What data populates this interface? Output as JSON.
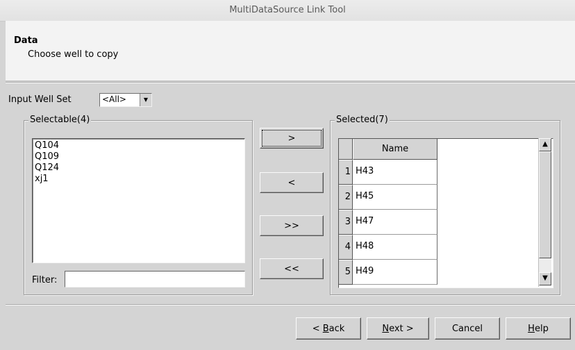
{
  "window": {
    "title": "MultiDataSource Link Tool"
  },
  "header": {
    "title": "Data",
    "subtitle": "Choose well to copy"
  },
  "input_well_set": {
    "label": "Input Well Set",
    "selected": "<All>"
  },
  "selectable": {
    "legend": "Selectable(4)",
    "items": [
      "Q104",
      "Q109",
      "Q124",
      "xj1"
    ],
    "filter_label": "Filter:",
    "filter_value": ""
  },
  "transfer_buttons": {
    "add": ">",
    "remove": "<",
    "add_all": ">>",
    "remove_all": "<<"
  },
  "selected": {
    "legend": "Selected(7)",
    "column": "Name",
    "rows": [
      {
        "num": "1",
        "name": "H43"
      },
      {
        "num": "2",
        "name": "H45"
      },
      {
        "num": "3",
        "name": "H47"
      },
      {
        "num": "4",
        "name": "H48"
      },
      {
        "num": "5",
        "name": "H49"
      }
    ]
  },
  "footer": {
    "back": {
      "mnemonic": "B",
      "rest": "ack",
      "prefix": "< "
    },
    "next": {
      "mnemonic": "N",
      "rest": "ext >"
    },
    "cancel": "Cancel",
    "help": {
      "mnemonic": "H",
      "rest": "elp"
    }
  },
  "icons": {
    "combo_arrow": "chevron-down-icon",
    "scroll_up": "arrow-up-icon",
    "scroll_down": "arrow-down-icon"
  }
}
